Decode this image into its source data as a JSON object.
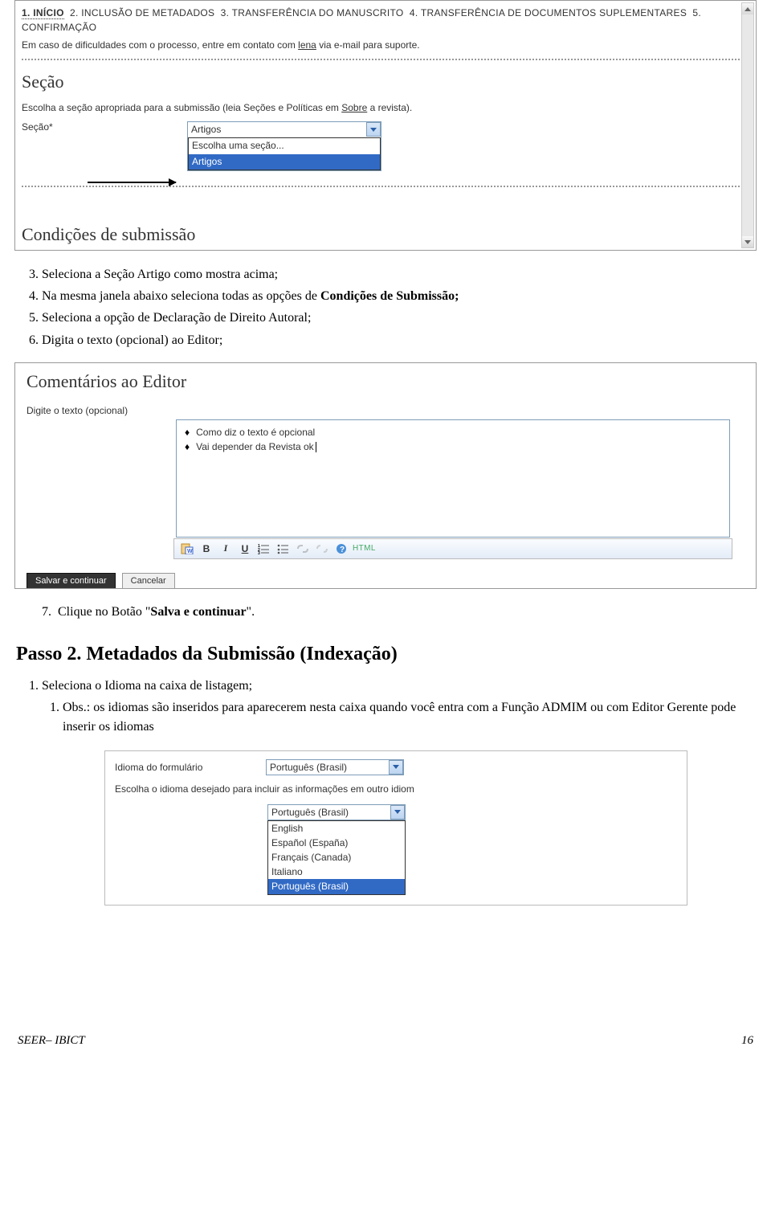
{
  "screenshot1": {
    "steps": [
      {
        "num": "1.",
        "label": "INÍCIO",
        "active": true
      },
      {
        "num": "2.",
        "label": "INCLUSÃO DE METADADOS"
      },
      {
        "num": "3.",
        "label": "TRANSFERÊNCIA DO MANUSCRITO"
      },
      {
        "num": "4.",
        "label": "TRANSFERÊNCIA DE DOCUMENTOS SUPLEMENTARES"
      },
      {
        "num": "5.",
        "label": "CONFIRMAÇÃO"
      }
    ],
    "help_pre": "Em caso de dificuldades com o processo, entre em contato com ",
    "help_link": "lena",
    "help_post": " via e-mail para suporte.",
    "secao_title": "Seção",
    "secao_help_pre": "Escolha a seção apropriada para a submissão (leia Seções e Políticas em ",
    "secao_help_link": "Sobre",
    "secao_help_post": " a revista).",
    "secao_label": "Seção*",
    "secao_selected": "Artigos",
    "secao_options": [
      "Escolha uma seção...",
      "Artigos"
    ],
    "cond_title": "Condições de submissão"
  },
  "instr1": [
    {
      "text": "Seleciona a Seção Artigo como mostra acima;",
      "start": 3
    },
    {
      "text_pre": "Na mesma janela abaixo seleciona todas as opções de ",
      "bold": "Condições de Submissão;"
    },
    {
      "text": "Seleciona a opção de Declaração de Direito Autoral;"
    },
    {
      "text": "Digita o texto (opcional) ao Editor;"
    }
  ],
  "screenshot2": {
    "title": "Comentários ao Editor",
    "label": "Digite o texto (opcional)",
    "bullets": [
      "Como diz o texto é opcional",
      "Vai depender da Revista ok"
    ],
    "toolbar_html": "HTML",
    "btn_save": "Salvar e continuar",
    "btn_cancel": "Cancelar"
  },
  "instr_after_ss2": {
    "num": "7.",
    "text_pre": "Clique no Botão \"",
    "bold": "Salva e continuar",
    "text_post": "\"."
  },
  "passo2_title": "Passo 2. Metadados da Submissão (Indexação)",
  "instr2": {
    "item1": "Seleciona o Idioma na caixa de listagem;",
    "sub_pre": "Obs.: os idiomas são inseridos para aparecerem nesta caixa quando você entra com a Função ADMIM ou com Editor Gerente pode inserir os idiomas"
  },
  "screenshot3": {
    "label": "Idioma do formulário",
    "selected": "Português (Brasil)",
    "help": "Escolha o idioma desejado para incluir as informações em outro idiom",
    "options": [
      "Português (Brasil)",
      "English",
      "Español (España)",
      "Français (Canada)",
      "Italiano",
      "Português (Brasil)"
    ],
    "highlighted_index": 5
  },
  "footer": {
    "left": "SEER– IBICT",
    "right": "16"
  }
}
